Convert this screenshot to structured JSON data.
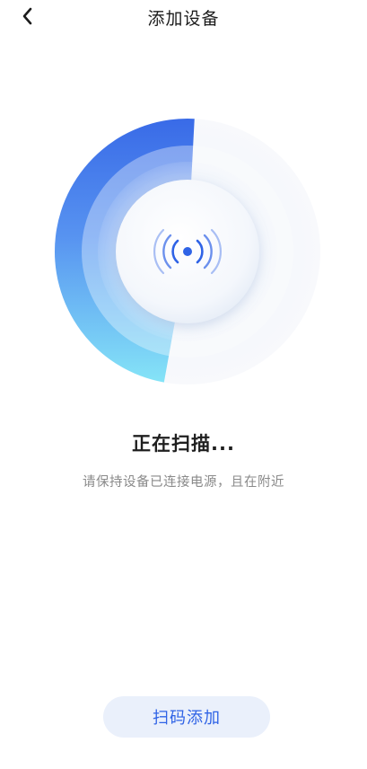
{
  "header": {
    "title": "添加设备",
    "back_icon": "chevron-left-icon"
  },
  "scanner": {
    "state": "scanning",
    "progress_fraction": 0.48,
    "center_icon": "wireless-signal-icon",
    "accent_colors": [
      "#2f63e6",
      "#5aa7f2",
      "#7fe3f7"
    ]
  },
  "status": {
    "title": "正在扫描...",
    "hint": "请保持设备已连接电源，且在附近"
  },
  "actions": {
    "scan_add_label": "扫码添加"
  }
}
